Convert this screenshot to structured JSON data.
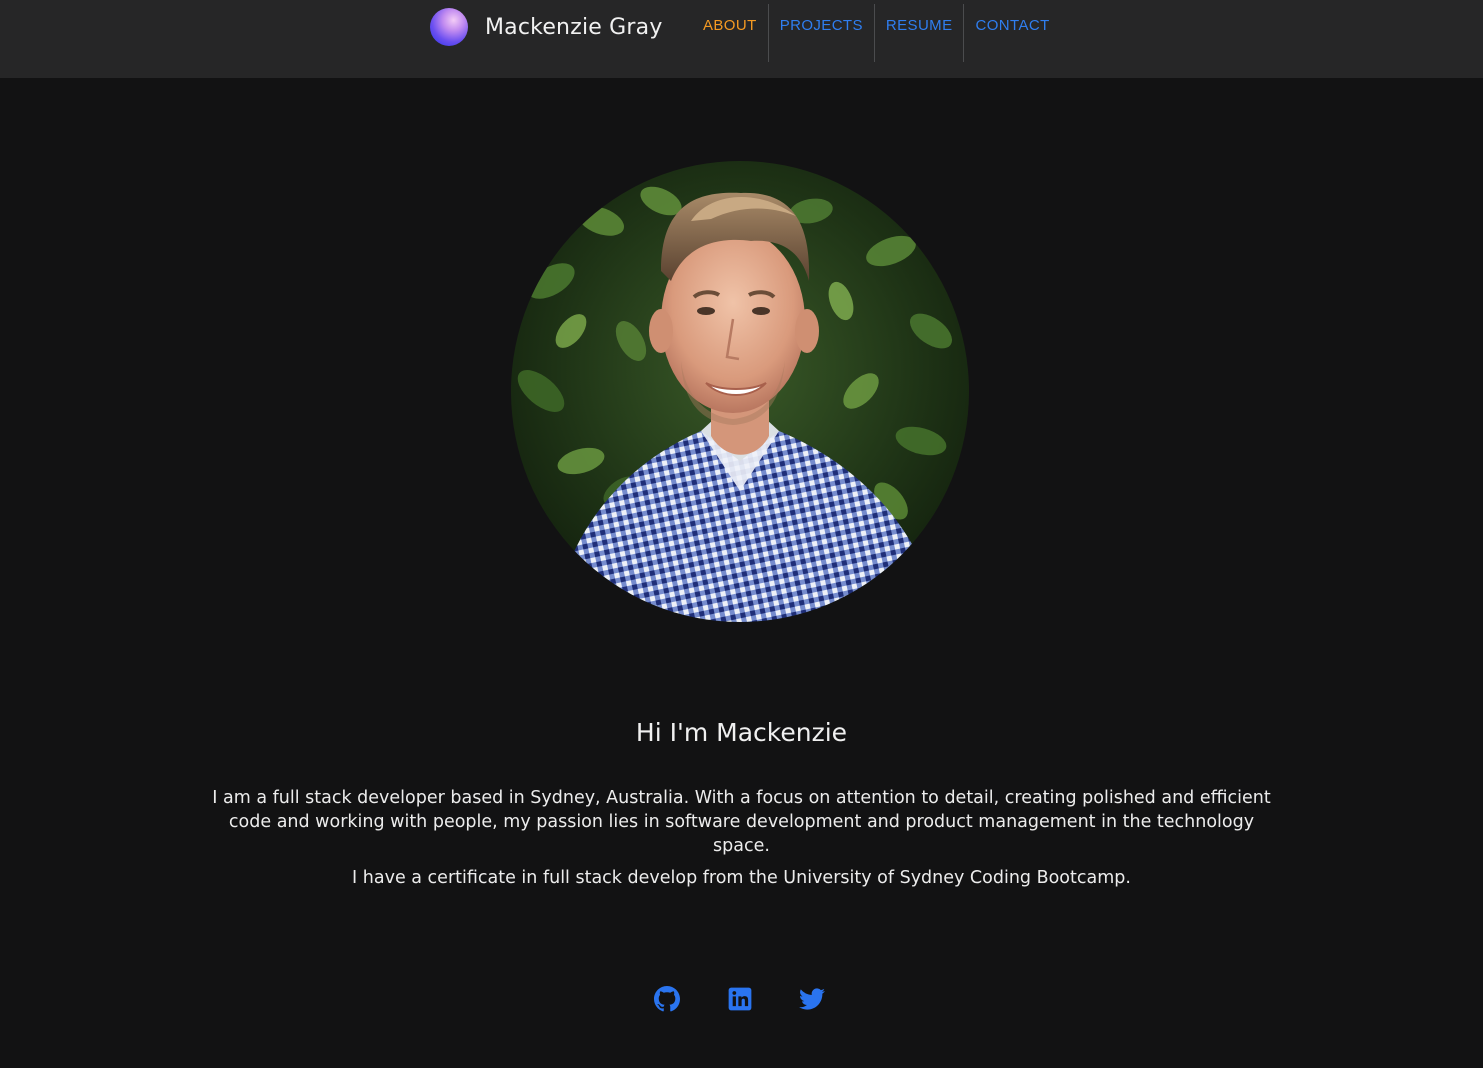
{
  "header": {
    "brand_name": "Mackenzie Gray",
    "nav": [
      {
        "label": "ABOUT",
        "active": true
      },
      {
        "label": "PROJECTS",
        "active": false
      },
      {
        "label": "RESUME",
        "active": false
      },
      {
        "label": "CONTACT",
        "active": false
      }
    ]
  },
  "about": {
    "headline": "Hi I'm Mackenzie",
    "bio": "I am a full stack developer based in Sydney, Australia. With a focus on attention to detail, creating polished and efficient code and working with people, my passion lies in software development and product management in the technology space.",
    "certificate": "I have a certificate in full stack develop from the University of Sydney Coding Bootcamp."
  },
  "social": [
    {
      "icon": "github-icon"
    },
    {
      "icon": "linkedin-icon"
    },
    {
      "icon": "twitter-icon"
    }
  ],
  "colors": {
    "page_background": "#121213",
    "header_background": "#262627",
    "link": "#2f7ef0",
    "active_link": "#f59a22",
    "text": "#f0f0f0"
  }
}
